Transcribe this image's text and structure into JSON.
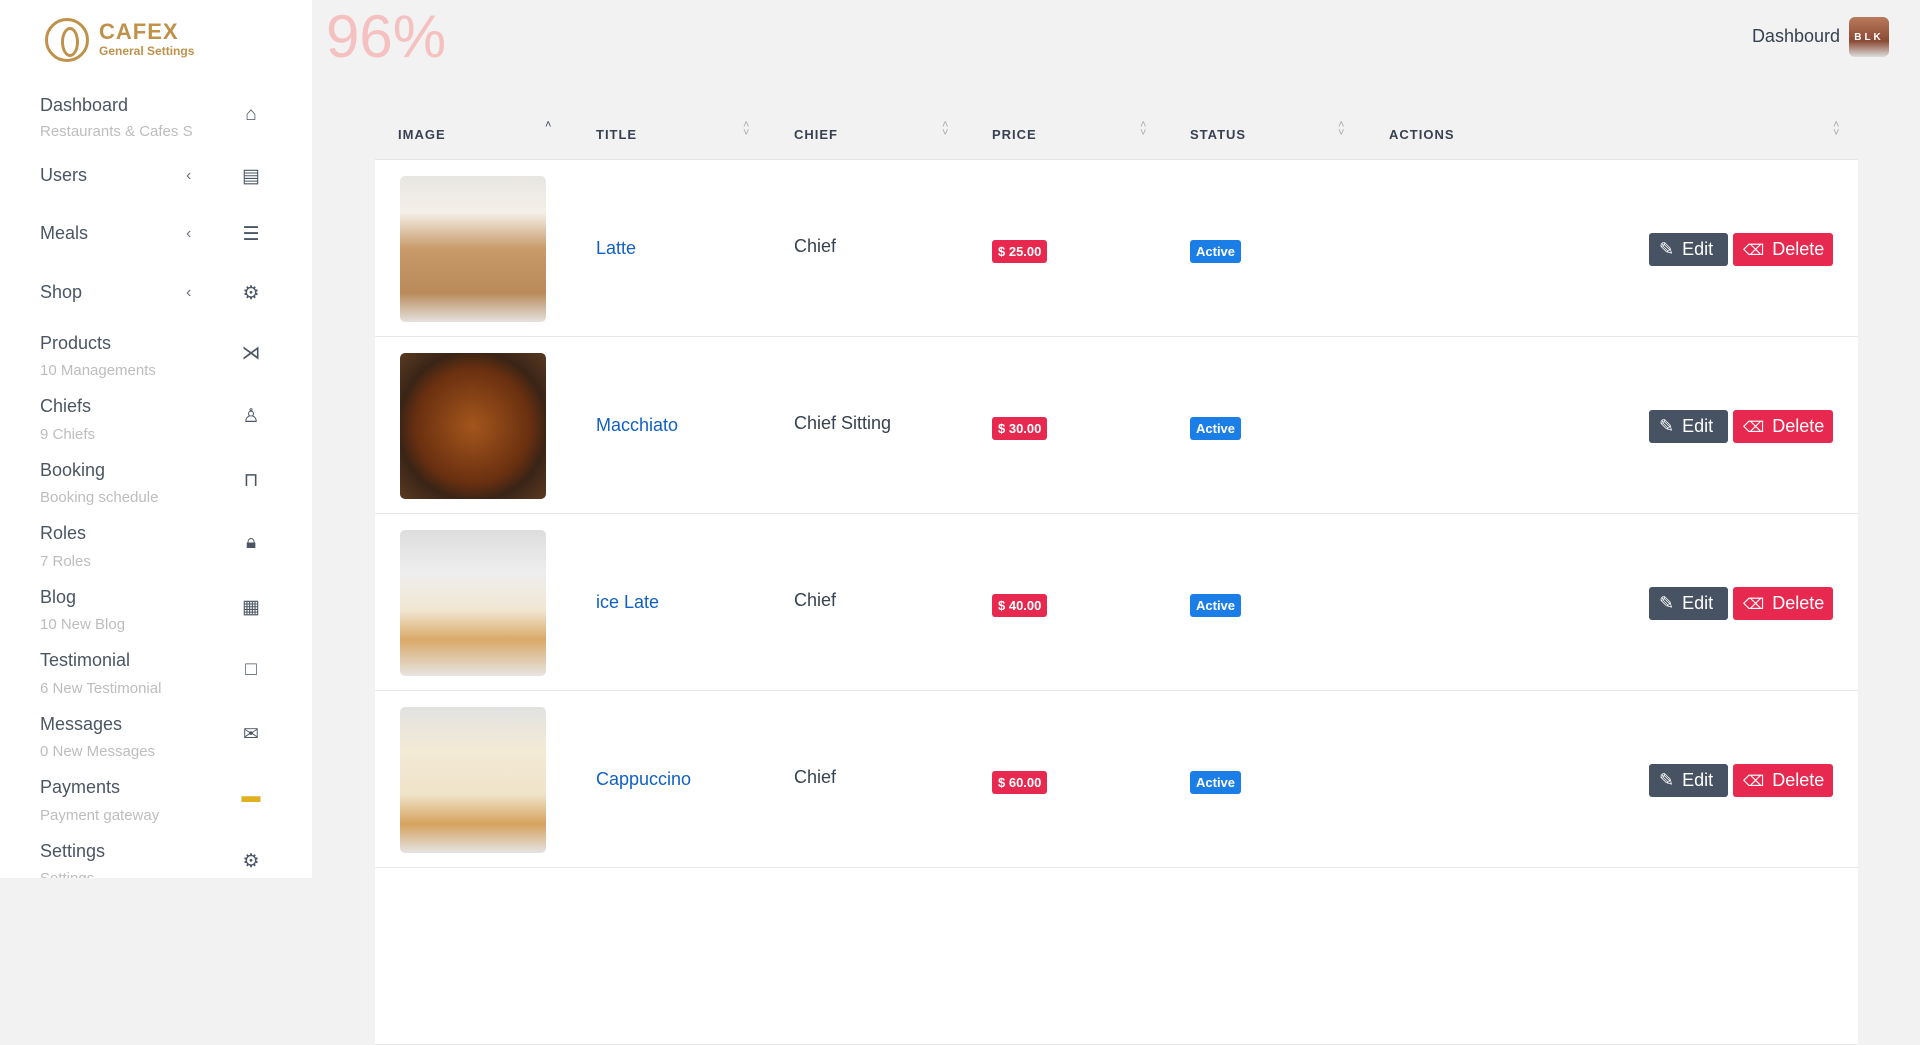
{
  "brand": {
    "name": "CAFEX",
    "subtitle": "General Settings"
  },
  "sidebar": [
    {
      "title": "Dashboard",
      "sub": "Restaurants & Cafes S",
      "icon": "home-icon"
    },
    {
      "title": "Users",
      "chevron": "‹",
      "icon": "id-card-icon"
    },
    {
      "title": "Meals",
      "chevron": "‹",
      "icon": "burger-icon"
    },
    {
      "title": "Shop",
      "chevron": "‹",
      "icon": "gear-badge-icon"
    },
    {
      "title": "Products",
      "sub": "10 Managements",
      "icon": "fish-icon"
    },
    {
      "title": "Chiefs",
      "sub": "9 Chiefs",
      "icon": "chef-icon"
    },
    {
      "title": "Booking",
      "sub": "Booking schedule",
      "icon": "table-icon"
    },
    {
      "title": "Roles",
      "sub": "7 Roles",
      "icon": "lock-icon"
    },
    {
      "title": "Blog",
      "sub": "10 New Blog",
      "icon": "newspaper-icon"
    },
    {
      "title": "Testimonial",
      "sub": "6 New Testimonial",
      "icon": "chat-icon"
    },
    {
      "title": "Messages",
      "sub": "0 New Messages",
      "icon": "mail-icon"
    },
    {
      "title": "Payments",
      "sub": "Payment gateway",
      "icon": "payment-card-icon"
    },
    {
      "title": "Settings",
      "sub": "Settings",
      "icon": "settings-icon"
    }
  ],
  "zoom": "96%",
  "header": {
    "user_label": "Dashbourd",
    "avatar_text": "BLK"
  },
  "table": {
    "columns": [
      "IMAGE",
      "TITLE",
      "CHIEF",
      "PRICE",
      "STATUS",
      "ACTIONS"
    ],
    "edit_label": "Edit",
    "delete_label": "Delete",
    "rows": [
      {
        "title": "Latte",
        "chief": "Chief",
        "price": "$ 25.00",
        "status": "Active"
      },
      {
        "title": "Macchiato",
        "chief": "Chief Sitting",
        "price": "$ 30.00",
        "status": "Active"
      },
      {
        "title": "ice Late",
        "chief": "Chief",
        "price": "$ 40.00",
        "status": "Active"
      },
      {
        "title": "Cappuccino",
        "chief": "Chief",
        "price": "$ 60.00",
        "status": "Active"
      }
    ]
  }
}
